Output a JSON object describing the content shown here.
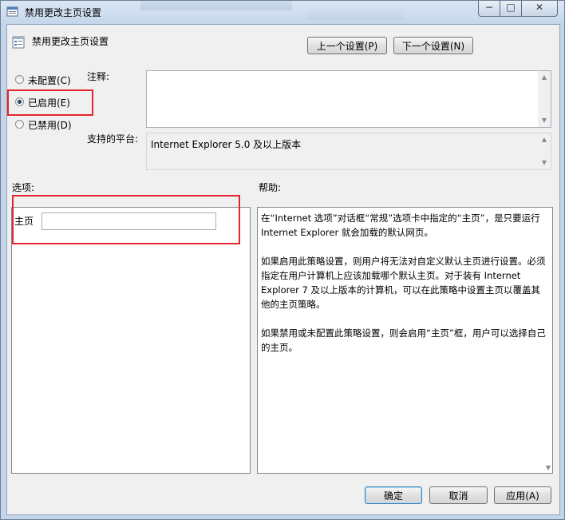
{
  "window": {
    "title": "禁用更改主页设置",
    "controls": {
      "minimize": "−",
      "maximize": "□",
      "close": "✕"
    }
  },
  "header": {
    "setting_name": "禁用更改主页设置",
    "prev_button": "上一个设置(P)",
    "next_button": "下一个设置(N)"
  },
  "state": {
    "options": [
      {
        "label": "未配置(C)",
        "selected": false
      },
      {
        "label": "已启用(E)",
        "selected": true
      },
      {
        "label": "已禁用(D)",
        "selected": false
      }
    ]
  },
  "comment": {
    "label": "注释:",
    "value": ""
  },
  "platform": {
    "label": "支持的平台:",
    "value": "Internet Explorer 5.0 及以上版本"
  },
  "options_section": {
    "label": "选项:",
    "homepage_label": "主页",
    "homepage_value": ""
  },
  "help_section": {
    "label": "帮助:",
    "paragraphs": [
      "在“Internet 选项”对话框“常规”选项卡中指定的“主页”，是只要运行 Internet Explorer 就会加载的默认网页。",
      "如果启用此策略设置，则用户将无法对自定义默认主页进行设置。必须指定在用户计算机上应该加载哪个默认主页。对于装有 Internet Explorer 7 及以上版本的计算机，可以在此策略中设置主页以覆盖其他的主页策略。",
      "如果禁用或未配置此策略设置，则会启用“主页”框，用户可以选择自己的主页。"
    ]
  },
  "footer": {
    "ok": "确定",
    "cancel": "取消",
    "apply": "应用(A)"
  },
  "colors": {
    "highlight_box": "#e5252c",
    "title_bar": "#c4d5ea"
  }
}
